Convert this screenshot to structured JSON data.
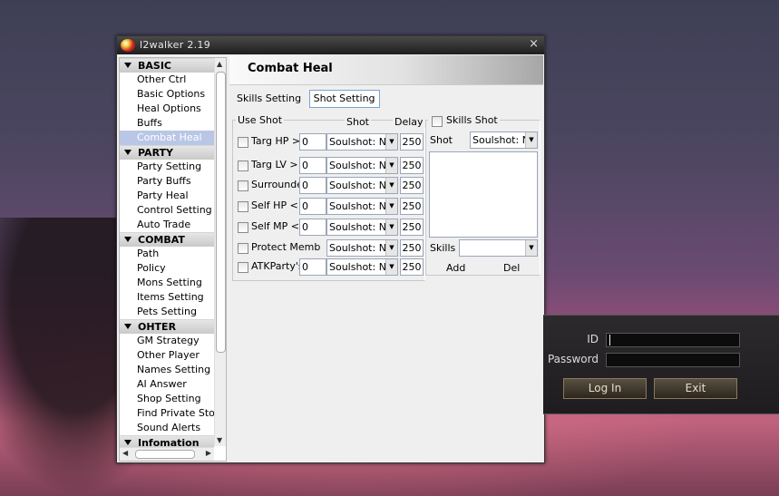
{
  "window": {
    "title": "l2walker 2.19",
    "close_glyph": "×"
  },
  "sidebar": {
    "categories": [
      {
        "label": "BASIC",
        "items": [
          "Other Ctrl",
          "Basic Options",
          "Heal Options",
          "Buffs",
          "Combat Heal"
        ]
      },
      {
        "label": "PARTY",
        "items": [
          "Party Setting",
          "Party Buffs",
          "Party Heal",
          "Control Setting",
          "Auto Trade"
        ]
      },
      {
        "label": "COMBAT",
        "items": [
          "Path",
          "Policy",
          "Mons Setting",
          "Items Setting",
          "Pets Setting"
        ]
      },
      {
        "label": "OHTER",
        "items": [
          "GM Strategy",
          "Other Player",
          "Names Setting",
          "AI Answer",
          "Shop Setting",
          "Find Private Store",
          "Sound Alerts"
        ]
      },
      {
        "label": "Infomation",
        "items": []
      }
    ],
    "selected": "Combat Heal"
  },
  "content": {
    "title": "Combat Heal",
    "tabs": {
      "skills": "Skills Setting",
      "shot": "Shot Setting",
      "active": "Shot Setting"
    },
    "use_shot": {
      "group_label": "Use Shot",
      "col_shot": "Shot",
      "col_delay": "Delay",
      "rows": [
        {
          "label": "Targ HP  >",
          "value": "0",
          "shot": "Soulshot: No",
          "delay": "250",
          "checked": false
        },
        {
          "label": "Targ LV  >",
          "value": "0",
          "shot": "Soulshot: No",
          "delay": "250",
          "checked": false
        },
        {
          "label": "Surrounde",
          "value": "0",
          "shot": "Soulshot: No",
          "delay": "250",
          "checked": false
        },
        {
          "label": "Self HP  <",
          "value": "0",
          "shot": "Soulshot: No",
          "delay": "250",
          "checked": false
        },
        {
          "label": "Self MP  <",
          "value": "0",
          "shot": "Soulshot: No",
          "delay": "250",
          "checked": false
        },
        {
          "label": "Protect Memb",
          "value": "",
          "shot": "Soulshot: No",
          "delay": "250",
          "checked": false
        },
        {
          "label": "ATKParty's",
          "value": "0",
          "shot": "Soulshot: No",
          "delay": "250",
          "checked": false
        }
      ]
    },
    "skills_shot": {
      "group_label": "Skills Shot",
      "checked": false,
      "shot_label": "Shot",
      "shot_value": "Soulshot: No",
      "skills_label": "Skills",
      "skills_value": "",
      "add_label": "Add",
      "del_label": "Del"
    }
  },
  "login": {
    "id_label": "ID",
    "password_label": "Password",
    "login_button": "Log In",
    "exit_button": "Exit"
  }
}
